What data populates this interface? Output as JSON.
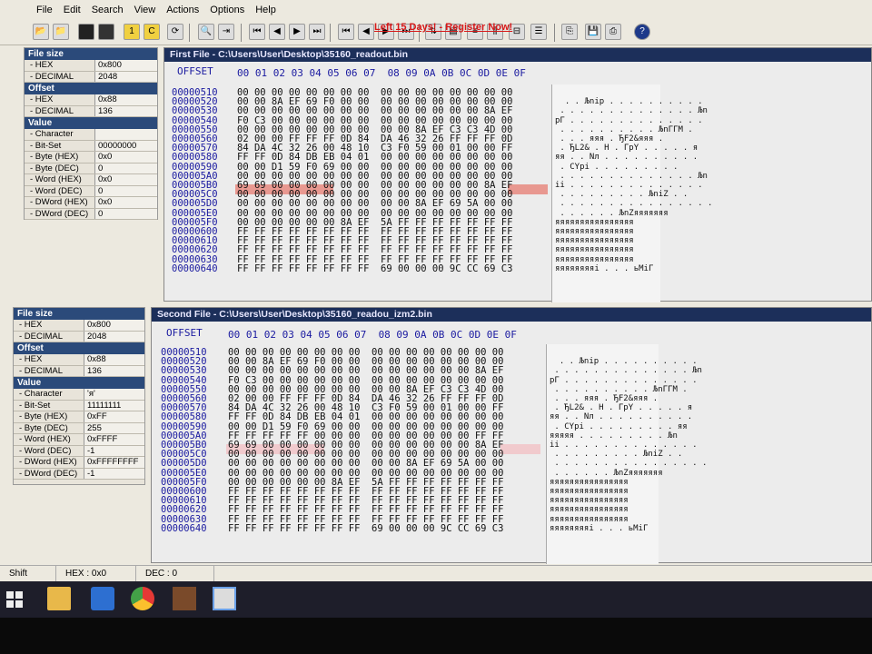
{
  "menu": [
    "File",
    "Edit",
    "Search",
    "View",
    "Actions",
    "Options",
    "Help"
  ],
  "banner": "Left 15 Days! - Register Now!",
  "panel1": {
    "rows": [
      {
        "k": "File size",
        "v": "",
        "head": true
      },
      {
        "k": "- HEX",
        "v": "0x800"
      },
      {
        "k": "- DECIMAL",
        "v": "2048"
      },
      {
        "k": "Offset",
        "v": "",
        "head": true
      },
      {
        "k": "- HEX",
        "v": "0x88"
      },
      {
        "k": "- DECIMAL",
        "v": "136"
      },
      {
        "k": "Value",
        "v": "",
        "head": true
      },
      {
        "k": "- Character",
        "v": ""
      },
      {
        "k": "- Bit-Set",
        "v": "00000000"
      },
      {
        "k": "- Byte (HEX)",
        "v": "0x0"
      },
      {
        "k": "- Byte (DEC)",
        "v": "0"
      },
      {
        "k": "- Word (HEX)",
        "v": "0x0"
      },
      {
        "k": "- Word (DEC)",
        "v": "0"
      },
      {
        "k": "- DWord (HEX)",
        "v": "0x0"
      },
      {
        "k": "- DWord (DEC)",
        "v": "0"
      }
    ]
  },
  "panel2": {
    "rows": [
      {
        "k": "File size",
        "v": "",
        "head": true
      },
      {
        "k": "- HEX",
        "v": "0x800"
      },
      {
        "k": "- DECIMAL",
        "v": "2048"
      },
      {
        "k": "Offset",
        "v": "",
        "head": true
      },
      {
        "k": "- HEX",
        "v": "0x88"
      },
      {
        "k": "- DECIMAL",
        "v": "136"
      },
      {
        "k": "Value",
        "v": "",
        "head": true
      },
      {
        "k": "- Character",
        "v": "'я'"
      },
      {
        "k": "- Bit-Set",
        "v": "11111111"
      },
      {
        "k": "- Byte (HEX)",
        "v": "0xFF"
      },
      {
        "k": "- Byte (DEC)",
        "v": "255"
      },
      {
        "k": "- Word (HEX)",
        "v": "0xFFFF"
      },
      {
        "k": "- Word (DEC)",
        "v": "-1"
      },
      {
        "k": "- DWord (HEX)",
        "v": "0xFFFFFFFF"
      },
      {
        "k": "- DWord (DEC)",
        "v": "-1"
      }
    ]
  },
  "file1": {
    "title": "First File - C:\\Users\\User\\Desktop\\35160_readout.bin",
    "offset_label": "OFFSET",
    "cols": "00 01 02 03 04 05 06 07  08 09 0A 0B 0C 0D 0E 0F",
    "offsets": "00000510\n00000520\n00000530\n00000540\n00000550\n00000560\n00000570\n00000580\n00000590\n000005A0\n000005B0\n000005C0\n000005D0\n000005E0\n000005F0\n00000600\n00000610\n00000620\n00000630\n00000640",
    "hex": "00 00 00 00 00 00 00 00  00 00 00 00 00 00 00 00\n00 00 8A EF 69 F0 00 00  00 00 00 00 00 00 00 00\n00 00 00 00 00 00 00 00  00 00 00 00 00 00 8A EF\nF0 C3 00 00 00 00 00 00  00 00 00 00 00 00 00 00\n00 00 00 00 00 00 00 00  00 00 8A EF C3 C3 4D 00\n02 00 00 FF FF FF 0D 84  DA 46 32 26 FF FF FF 0D\n84 DA 4C 32 26 00 48 10  C3 F0 59 00 01 00 00 FF\nFF FF 0D 84 DB EB 04 01  00 00 00 00 00 00 00 00\n00 00 D1 59 F0 69 00 00  00 00 00 00 00 00 00 00\n00 00 00 00 00 00 00 00  00 00 00 00 00 00 00 00\n69 69 00 00 00 00 00 00  00 00 00 00 00 00 8A EF\n00 00 00 00 00 00 00 00  00 00 00 00 00 00 00 00\n00 00 00 00 00 00 00 00  00 00 8A EF 69 5A 00 00\n00 00 00 00 00 00 00 00  00 00 00 00 00 00 00 00\n00 00 00 00 00 00 8A EF  5A FF FF FF FF FF FF FF\nFF FF FF FF FF FF FF FF  FF FF FF FF FF FF FF FF\nFF FF FF FF FF FF FF FF  FF FF FF FF FF FF FF FF\nFF FF FF FF FF FF FF FF  FF FF FF FF FF FF FF FF\nFF FF FF FF FF FF FF FF  FF FF FF FF FF FF FF FF\nFF FF FF FF FF FF FF FF  69 00 00 00 9C CC 69 C3",
    "ascii": "\n  . . Љnip . . . . . . . . . .\n . . . . . . . . . . . . . . Љn\nрГ . . . . . . . . . . . . . .\n . . . . . . . . . . ЉnГГМ .\n . . . яяя . ЂF2&яяя .\n . ЂL2& . Н . ГрY . . . . . я\nяя . . Nл . . . . . . . . . .\n . СYpi . . . . . . . . .\n . . . . . . . . . . . . . . Љn\nii . . . . . . . . . . . . . .\n . . . . . . . . . ЉniZ . .\n . . . . . . . . . . . . . . . .\n . . . . . . ЉnZяяяяяяя\nяяяяяяяяяяяяяяяя\nяяяяяяяяяяяяяяяя\nяяяяяяяяяяяяяяяя\nяяяяяяяяяяяяяяяя\nяяяяяяяяяяяяяяяя\nяяяяяяяяi . . . ьМiГ"
  },
  "file2": {
    "title": "Second File - C:\\Users\\User\\Desktop\\35160_readou_izm2.bin",
    "offset_label": "OFFSET",
    "cols": "00 01 02 03 04 05 06 07  08 09 0A 0B 0C 0D 0E 0F",
    "offsets": "00000510\n00000520\n00000530\n00000540\n00000550\n00000560\n00000570\n00000580\n00000590\n000005A0\n000005B0\n000005C0\n000005D0\n000005E0\n000005F0\n00000600\n00000610\n00000620\n00000630\n00000640",
    "hex": "00 00 00 00 00 00 00 00  00 00 00 00 00 00 00 00\n00 00 8A EF 69 F0 00 00  00 00 00 00 00 00 00 00\n00 00 00 00 00 00 00 00  00 00 00 00 00 00 8A EF\nF0 C3 00 00 00 00 00 00  00 00 00 00 00 00 00 00\n00 00 00 00 00 00 00 00  00 00 8A EF C3 C3 4D 00\n02 00 00 FF FF FF 0D 84  DA 46 32 26 FF FF FF 0D\n84 DA 4C 32 26 00 48 10  C3 F0 59 00 01 00 00 FF\nFF FF 0D 84 DB EB 04 01  00 00 00 00 00 00 00 00\n00 00 D1 59 F0 69 00 00  00 00 00 00 00 00 00 00\nFF FF FF FF FF 00 00 00  00 00 00 00 00 00 FF FF\n69 69 00 00 00 00 00 00  00 00 00 00 00 00 8A EF\n00 00 00 00 00 00 00 00  00 00 00 00 00 00 00 00\n00 00 00 00 00 00 00 00  00 00 8A EF 69 5A 00 00\n00 00 00 00 00 00 00 00  00 00 00 00 00 00 00 00\n00 00 00 00 00 00 8A EF  5A FF FF FF FF FF FF FF\nFF FF FF FF FF FF FF FF  FF FF FF FF FF FF FF FF\nFF FF FF FF FF FF FF FF  FF FF FF FF FF FF FF FF\nFF FF FF FF FF FF FF FF  FF FF FF FF FF FF FF FF\nFF FF FF FF FF FF FF FF  FF FF FF FF FF FF FF FF\nFF FF FF FF FF FF FF FF  69 00 00 00 9C CC 69 C3",
    "ascii": "\n  . . Љnip . . . . . . . . . .\n . . . . . . . . . . . . . . Љn\nрГ . . . . . . . . . . . . . .\n . . . . . . . . . . ЉnГГМ .\n . . . яяя . ЂF2&яяя .\n . ЂL2& . Н . ГрY . . . . . я\nяя . . Nл . . . . . . . . . .\n . СYpi . . . . . . . . . яя\nяяяяя . . . . . . . . . Љn\nii . . . . . . . . . . . . . .\n . . . . . . . . . ЉniZ . .\n . . . . . . . . . . . . . . . .\n . . . . . . ЉnZяяяяяяя\nяяяяяяяяяяяяяяяя\nяяяяяяяяяяяяяяяя\nяяяяяяяяяяяяяяяя\nяяяяяяяяяяяяяяяя\nяяяяяяяяяяяяяяяя\nяяяяяяяяi . . . ьМiГ"
  },
  "status": {
    "mode": "Shift",
    "hex": "HEX : 0x0",
    "dec": "DEC : 0"
  },
  "colors": {
    "title_bar": "#1c2f5a",
    "panel_head": "#2b4a7a",
    "highlight": "#e88a80",
    "banner": "#d81818"
  }
}
